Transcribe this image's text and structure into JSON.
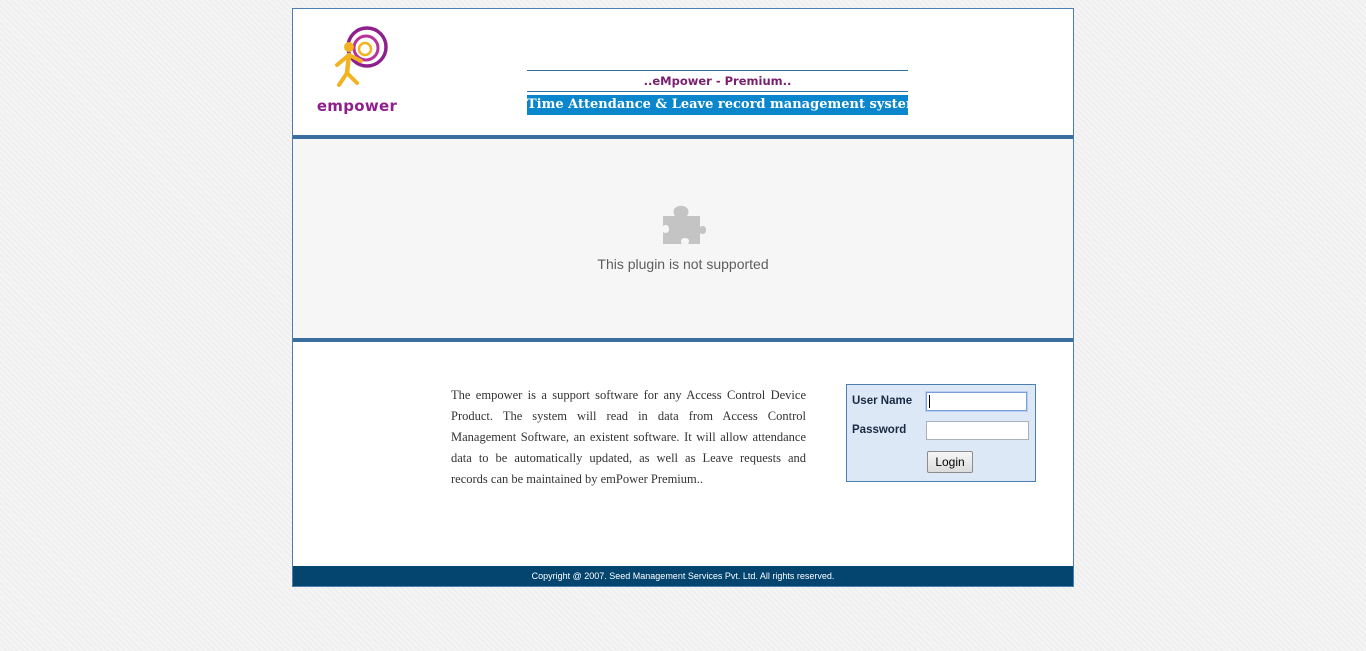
{
  "header": {
    "logo_text": "empower",
    "subtitle": "..eMpower - Premium..",
    "tagline": "Time Attendance & Leave record management system"
  },
  "plugin": {
    "icon": "puzzle-piece-icon",
    "message": "This plugin is not supported"
  },
  "description": "The empower  is a support software for any Access Control Device Product. The system will read in data from Access Control Management Software, an existent software. It will allow attendance data to be automatically updated, as well as Leave requests and records can be maintained by emPower Premium..",
  "login": {
    "username_label": "User Name",
    "username_value": "",
    "password_label": "Password",
    "password_value": "",
    "button_label": "Login"
  },
  "footer": {
    "copyright": "Copyright @ 2007. Seed Management Services Pvt. Ltd. All rights reserved."
  },
  "colors": {
    "brand_purple": "#8e1f8c",
    "brand_yellow": "#f2b320",
    "tagline_blue": "#0a86cc",
    "footer_navy": "#03456f"
  }
}
